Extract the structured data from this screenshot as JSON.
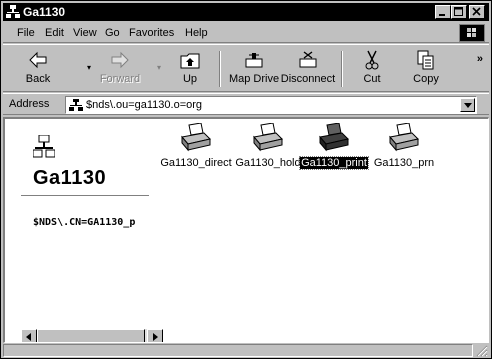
{
  "window": {
    "title": "Ga1130"
  },
  "menu": [
    {
      "label": "File",
      "key": "F"
    },
    {
      "label": "Edit",
      "key": "E"
    },
    {
      "label": "View",
      "key": "V"
    },
    {
      "label": "Go",
      "key": "G"
    },
    {
      "label": "Favorites",
      "key": "a"
    },
    {
      "label": "Help",
      "key": "H"
    }
  ],
  "toolbar": {
    "back": "Back",
    "forward": "Forward",
    "up": "Up",
    "map_drive": "Map Drive",
    "disconnect": "Disconnect",
    "cut": "Cut",
    "copy": "Copy",
    "more": "»"
  },
  "address": {
    "label": "Address",
    "value": "$nds\\.ou=ga1130.o=org"
  },
  "folder": {
    "title": "Ga1130",
    "path": "$NDS\\.CN=GA1130_p"
  },
  "items": [
    {
      "label": "Ga1130_direct",
      "selected": false
    },
    {
      "label": "Ga1130_hold",
      "selected": false
    },
    {
      "label": "Ga1130_print",
      "selected": true
    },
    {
      "label": "Ga1130_prn",
      "selected": false
    }
  ],
  "status": {
    "text": ""
  },
  "colors": {
    "titlebar": "#000000",
    "chrome": "#c0c0c0",
    "selection": "#000000",
    "content_bg": "#ffffff"
  },
  "icons": {
    "title": "network-icon",
    "back": "back-arrow-icon",
    "forward": "forward-arrow-icon",
    "up": "folder-up-icon",
    "map_drive": "map-drive-icon",
    "disconnect": "disconnect-icon",
    "cut": "scissors-icon",
    "copy": "copy-icon",
    "folder": "network-icon",
    "item": "printer-icon"
  }
}
